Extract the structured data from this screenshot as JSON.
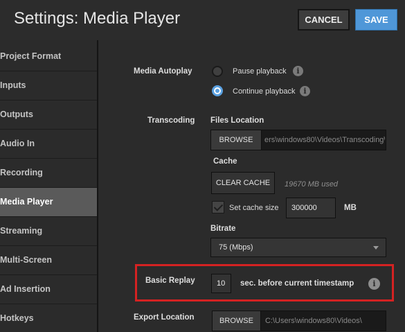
{
  "header": {
    "title": "Settings: Media Player",
    "cancel_label": "CANCEL",
    "save_label": "SAVE"
  },
  "sidebar": {
    "items": [
      {
        "label": "Project Format"
      },
      {
        "label": "Inputs"
      },
      {
        "label": "Outputs"
      },
      {
        "label": "Audio In"
      },
      {
        "label": "Recording"
      },
      {
        "label": "Media Player"
      },
      {
        "label": "Streaming"
      },
      {
        "label": "Multi-Screen"
      },
      {
        "label": "Ad Insertion"
      },
      {
        "label": "Hotkeys"
      }
    ],
    "active": "Media Player"
  },
  "media_autoplay": {
    "label": "Media Autoplay",
    "options": [
      {
        "label": "Pause playback",
        "checked": false
      },
      {
        "label": "Continue playback",
        "checked": true
      }
    ]
  },
  "transcoding": {
    "label": "Transcoding",
    "files_location_label": "Files Location",
    "browse_label": "BROWSE",
    "files_location_value": "ers\\windows80\\Videos\\Transcoding\\",
    "cache_label": "Cache",
    "clear_cache_label": "CLEAR CACHE",
    "cache_used": "19670 MB used",
    "set_cache_size_label": "Set cache size",
    "set_cache_size_checked": true,
    "cache_size_value": "300000",
    "cache_size_unit": "MB",
    "bitrate_label": "Bitrate",
    "bitrate_value": "75 (Mbps)"
  },
  "basic_replay": {
    "label": "Basic Replay",
    "value": "10",
    "suffix": "sec. before current timestamp"
  },
  "export_location": {
    "label": "Export Location",
    "browse_label": "BROWSE",
    "value": "C:\\Users\\windows80\\Videos\\"
  },
  "colors": {
    "accent": "#4f97d8",
    "highlight": "#d42222"
  }
}
